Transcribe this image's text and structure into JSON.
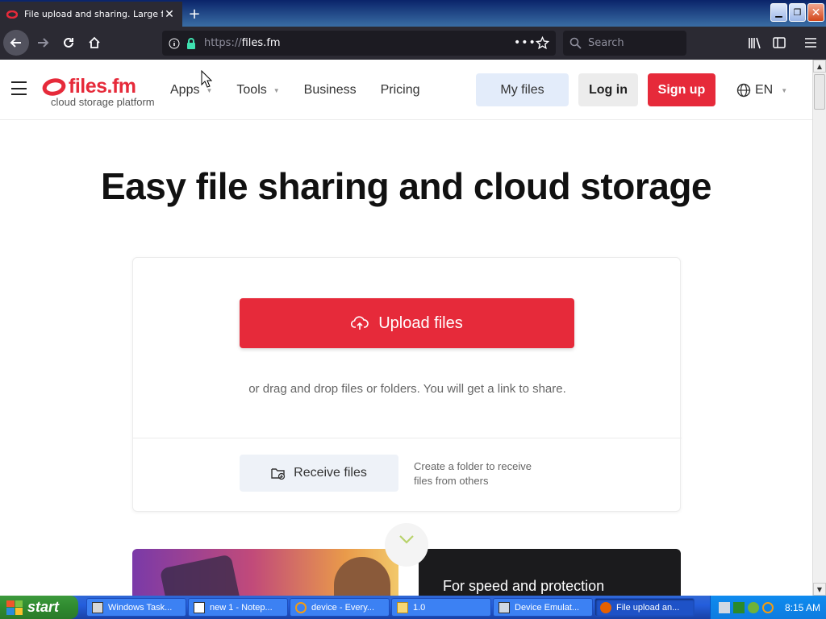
{
  "browser": {
    "tab_title": "File upload and sharing. Large file",
    "new_tab": "+",
    "url_protocol": "https://",
    "url_host": "files.fm",
    "search_placeholder": "Search"
  },
  "site": {
    "logo_name": "files.fm",
    "logo_tagline": "cloud storage platform",
    "nav": [
      {
        "label": "Apps"
      },
      {
        "label": "Tools"
      },
      {
        "label": "Business"
      },
      {
        "label": "Pricing"
      }
    ],
    "my_files": "My files",
    "log_in": "Log in",
    "sign_up": "Sign up",
    "language": "EN",
    "brand_color": "#e62a3a"
  },
  "hero": {
    "title": "Easy file sharing and cloud storage",
    "upload_label": "Upload files",
    "drag_text": "or drag and drop files or folders. You will get a link to share.",
    "receive_label": "Receive files",
    "receive_desc": "Create a folder to receive files from others"
  },
  "promos": {
    "card2_title": "For speed and protection"
  },
  "taskbar": {
    "start": "start",
    "tasks": [
      {
        "label": "Windows Task..."
      },
      {
        "label": "new 1 - Notep..."
      },
      {
        "label": "device - Every..."
      },
      {
        "label": "1.0"
      },
      {
        "label": "Device Emulat..."
      },
      {
        "label": "File upload an..."
      }
    ],
    "clock": "8:15 AM"
  }
}
